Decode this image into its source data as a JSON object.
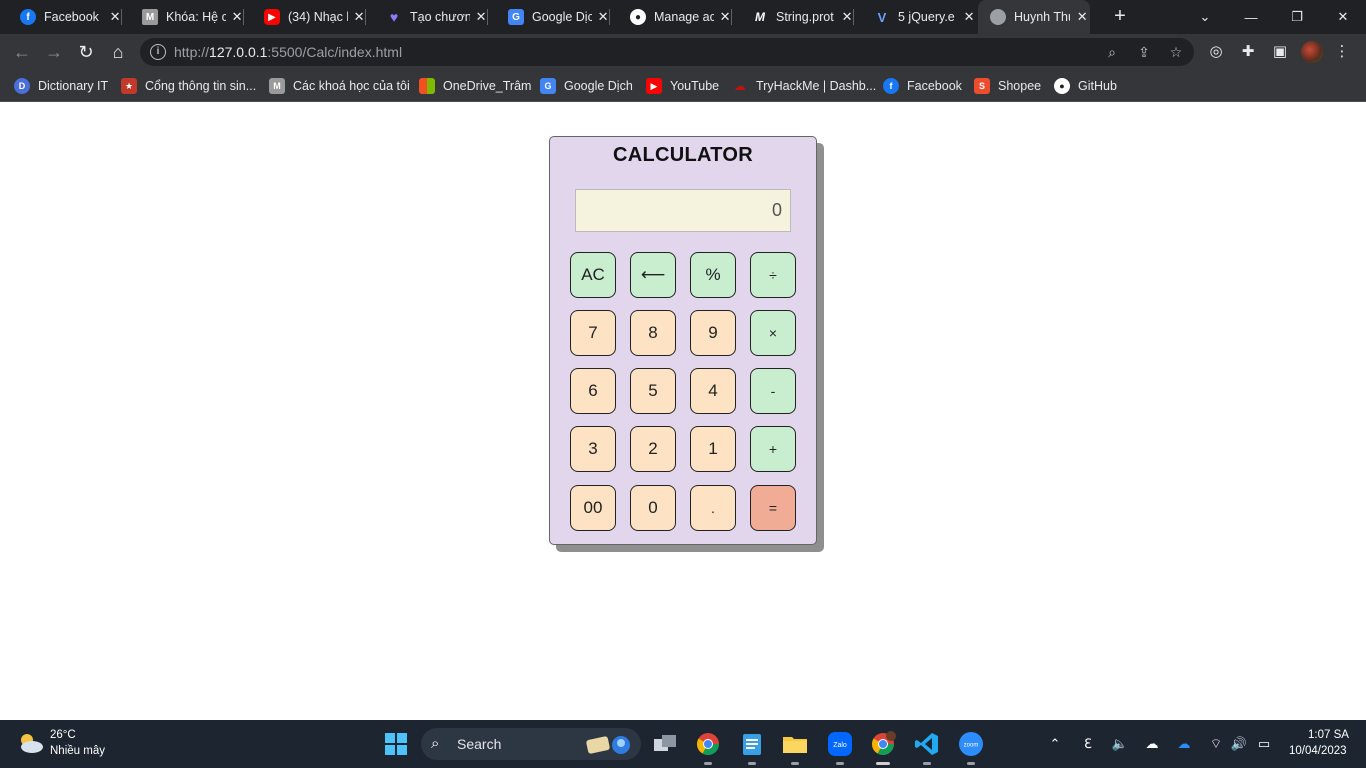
{
  "browser": {
    "tabs": [
      {
        "title": "Facebook",
        "icon": "facebook-icon",
        "color": "#1877f2"
      },
      {
        "title": "Khóa: Hệ cơ",
        "icon": "moodle-icon",
        "color": "#9a9a9a"
      },
      {
        "title": "(34) Nhạc l",
        "icon": "youtube-icon",
        "color": "#ff0000"
      },
      {
        "title": "Tạo chương",
        "icon": "heart-icon",
        "color": "#7b61ff"
      },
      {
        "title": "Google Dịch",
        "icon": "google-translate-icon",
        "color": "#4285f4"
      },
      {
        "title": "Manage ac",
        "icon": "github-icon",
        "color": "#ffffff"
      },
      {
        "title": "String.prot",
        "icon": "mdn-icon",
        "color": "#000000"
      },
      {
        "title": "5 jQuery.e",
        "icon": "vue-icon",
        "color": "#3a7bd5"
      },
      {
        "title": "Huynh Thu",
        "icon": "globe-icon",
        "color": "#9aa0a6"
      }
    ],
    "url_host": "http://127.0.0.1",
    "url_host_bold": "127.0.0.1",
    "url_prefix": "http://",
    "url_rest": ":5500/Calc/index.html",
    "bookmarks": [
      {
        "label": "Dictionary IT",
        "icon": "dictionary-icon",
        "color": "#4a6fd8"
      },
      {
        "label": "Cổng thông tin sin...",
        "icon": "portal-icon",
        "color": "#c0392b"
      },
      {
        "label": "Các khoá học của tôi",
        "icon": "moodle-icon",
        "color": "#9a9a9a"
      },
      {
        "label": "OneDrive_Trâm",
        "icon": "microsoft-icon",
        "color": "#f25022"
      },
      {
        "label": "Google Dịch",
        "icon": "google-translate-icon",
        "color": "#4285f4"
      },
      {
        "label": "YouTube",
        "icon": "youtube-icon",
        "color": "#ff0000"
      },
      {
        "label": "TryHackMe | Dashb...",
        "icon": "tryhackme-icon",
        "color": "#c11111"
      },
      {
        "label": "Facebook",
        "icon": "facebook-icon",
        "color": "#1877f2"
      },
      {
        "label": "Shopee",
        "icon": "shopee-icon",
        "color": "#ee4d2d"
      },
      {
        "label": "GitHub",
        "icon": "github-icon",
        "color": "#ffffff"
      }
    ]
  },
  "calculator": {
    "title": "CALCULATOR",
    "display": "0",
    "keys": {
      "ac": "AC",
      "back": "⟵",
      "percent": "%",
      "divide": "÷",
      "seven": "7",
      "eight": "8",
      "nine": "9",
      "multiply": "×",
      "six": "6",
      "five": "5",
      "four": "4",
      "minus": "-",
      "three": "3",
      "two": "2",
      "one": "1",
      "plus": "+",
      "double_zero": "00",
      "zero": "0",
      "dot": ".",
      "equals": "="
    },
    "colors": {
      "panel": "#e1d6ec",
      "display": "#f5f3dd",
      "number_key": "#fde3c3",
      "operator_key": "#c9eecf",
      "equals_key": "#f0ac95"
    }
  },
  "taskbar": {
    "weather_temp": "26°C",
    "weather_desc": "Nhiều mây",
    "search_label": "Search",
    "time": "1:07 SA",
    "date": "10/04/2023"
  }
}
